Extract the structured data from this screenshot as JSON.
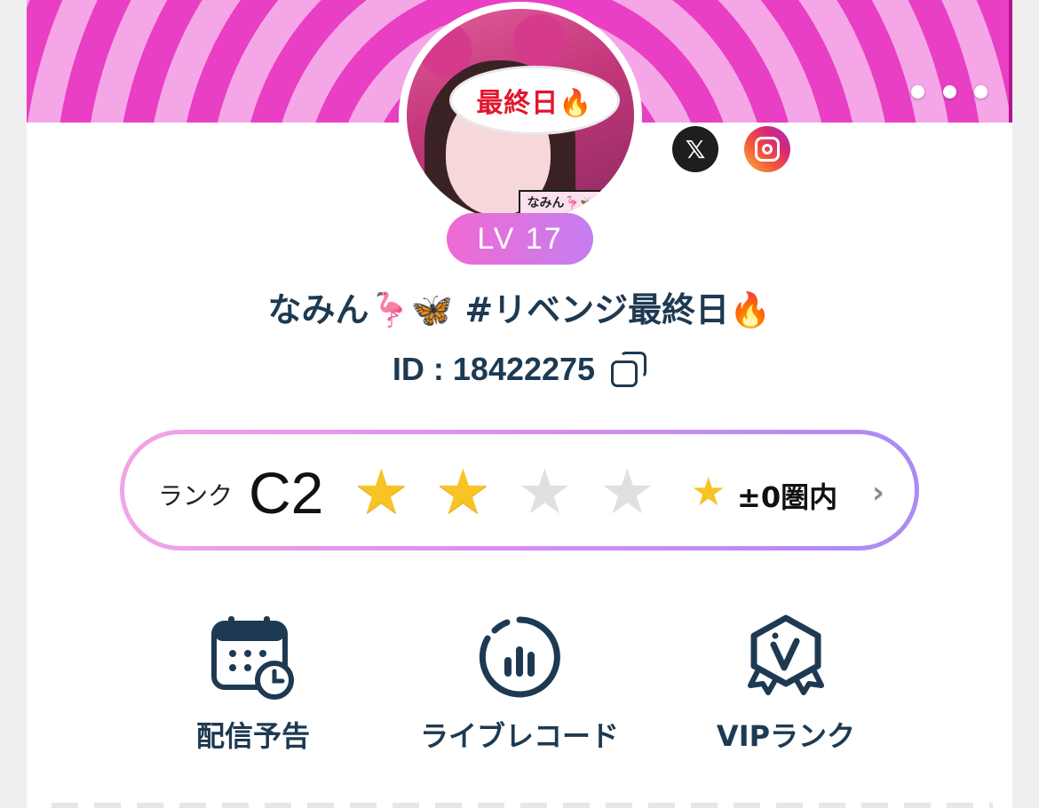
{
  "profile": {
    "avatar_bubble_text": "最終日🔥",
    "avatar_tag_text": "なみん🦩🦋",
    "level_text": "LV 17",
    "name": "なみん🦩🦋 #リベンジ最終日🔥",
    "id_text": "ID : 18422275"
  },
  "social": {
    "x_label": "𝕏",
    "instagram_label": "Instagram"
  },
  "rank": {
    "label": "ランク",
    "value": "C2",
    "stars_filled": 2,
    "stars_total": 4,
    "status": "±0圏内"
  },
  "actions": [
    {
      "label": "配信予告",
      "icon": "calendar-clock-icon"
    },
    {
      "label": "ライブレコード",
      "icon": "chart-circle-icon"
    },
    {
      "label": "VIPランク",
      "icon": "vip-badge-icon"
    }
  ],
  "colors": {
    "accent_pink": "#e93fc4",
    "text_navy": "#1d3a52",
    "star_gold": "#f7c325",
    "star_grey": "#e0e0e0"
  }
}
